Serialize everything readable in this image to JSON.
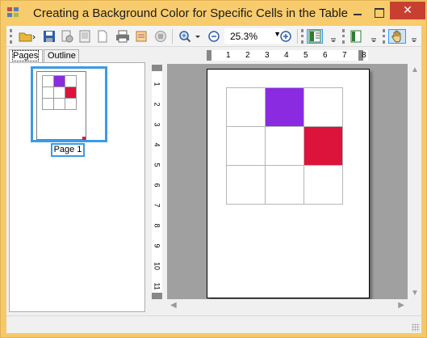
{
  "window": {
    "title": "Creating a Background Color for Specific Cells in the Table",
    "close_glyph": "✕",
    "accent": "#f8cb6c"
  },
  "toolbar": {
    "zoom_value": "25.3%",
    "icons": [
      "open-icon",
      "save-icon",
      "page-setup-icon",
      "print-preview-icon",
      "export-icon",
      "print-icon",
      "email-icon",
      "stop-icon",
      "zoom-in-icon",
      "zoom-out-icon",
      "zoom-plus-icon",
      "thumbnails-icon",
      "bookmarks-icon",
      "hand-tool-icon"
    ]
  },
  "tabs": [
    {
      "label": "Pages",
      "selected": true
    },
    {
      "label": "Outline",
      "selected": false
    }
  ],
  "thumbnail": {
    "label": "Page 1"
  },
  "ruler": {
    "horizontal": [
      "1",
      "2",
      "3",
      "4",
      "5",
      "6",
      "7",
      "8"
    ],
    "vertical": [
      "1",
      "2",
      "3",
      "4",
      "5",
      "6",
      "7",
      "8",
      "9",
      "10",
      "11"
    ]
  },
  "table": {
    "rows": [
      [
        "#ffffff",
        "#8a2be2",
        "#ffffff"
      ],
      [
        "#ffffff",
        "#ffffff",
        "#dc143c"
      ],
      [
        "#ffffff",
        "#ffffff",
        "#ffffff"
      ]
    ]
  }
}
